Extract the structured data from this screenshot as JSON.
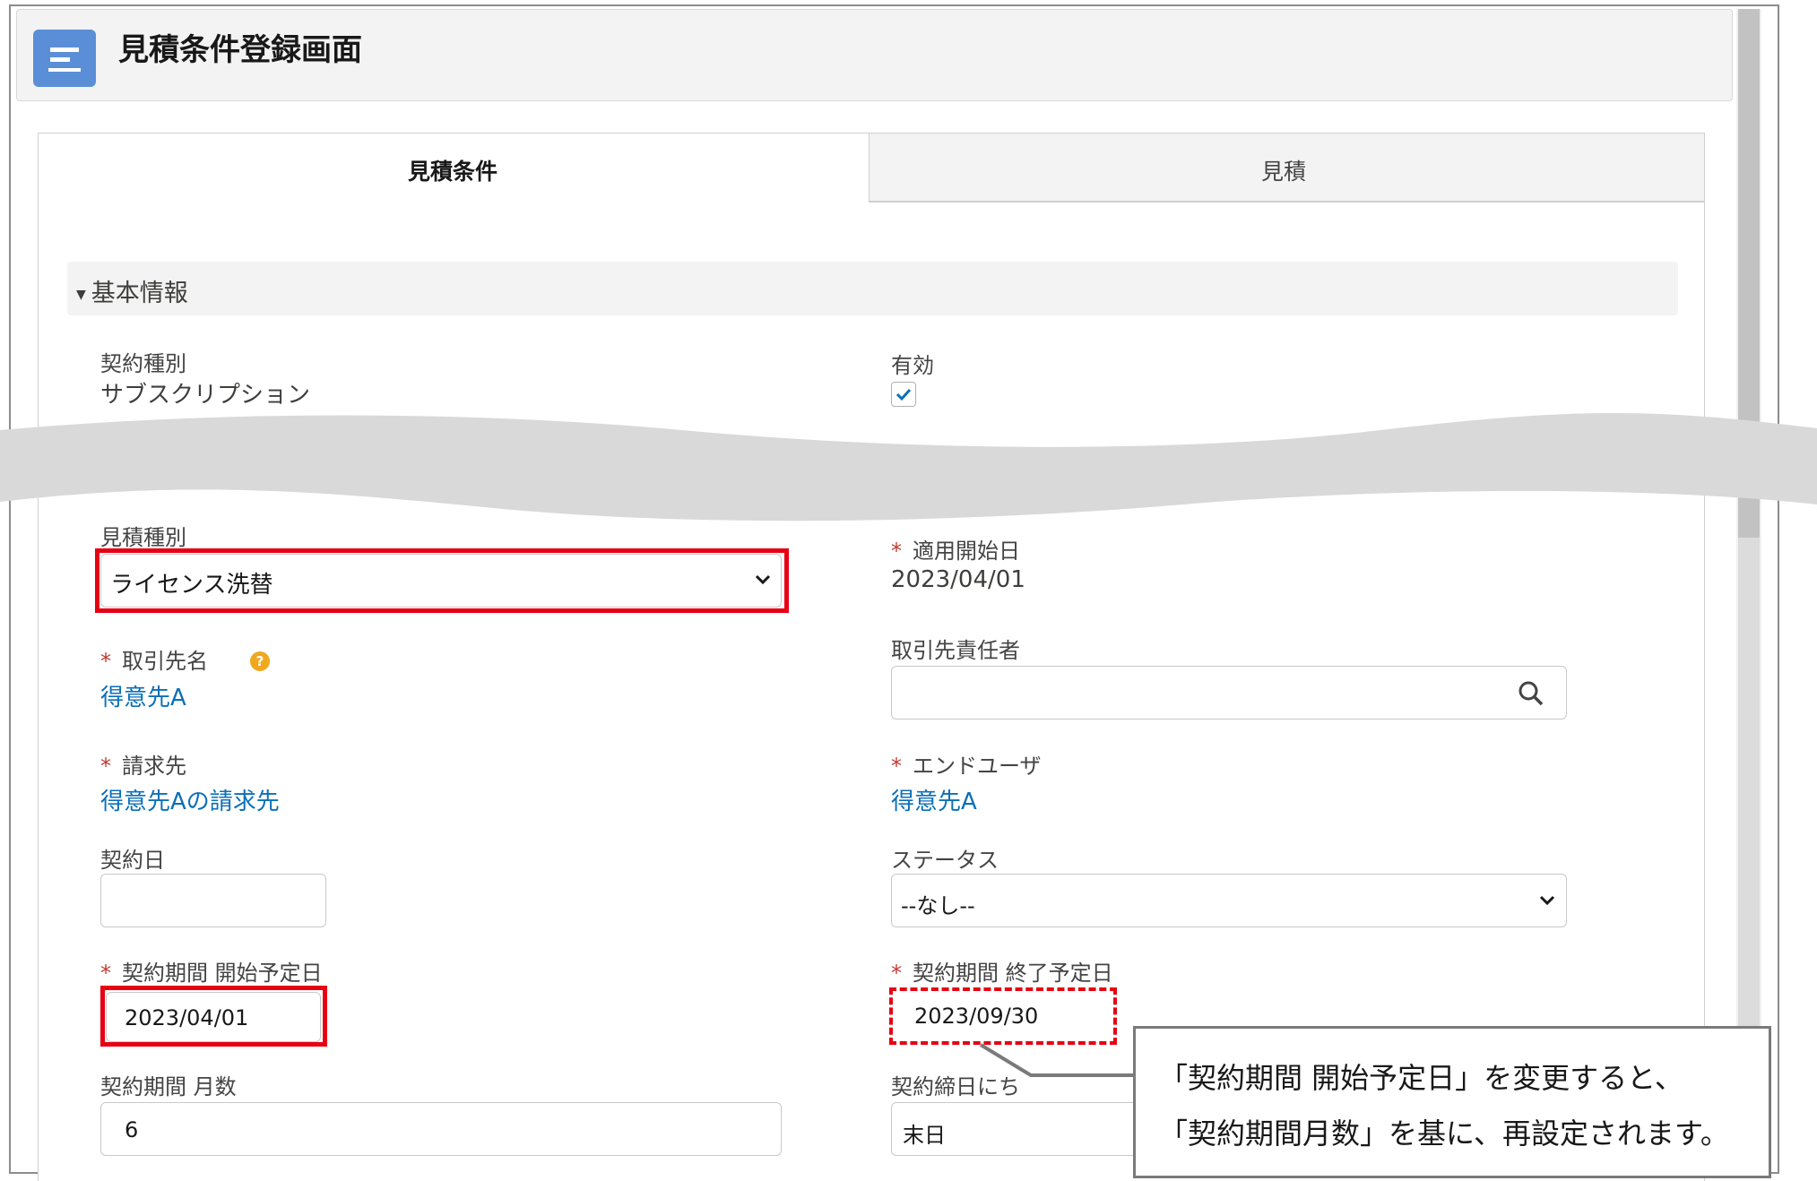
{
  "header": {
    "title": "見積条件登録画面"
  },
  "tabs": [
    {
      "label": "見積条件"
    },
    {
      "label": "見積"
    }
  ],
  "section": {
    "title": "基本情報"
  },
  "fields": {
    "contract_type": {
      "label": "契約種別",
      "value": "サブスクリプション"
    },
    "active": {
      "label": "有効",
      "checked": true
    },
    "estimate_type": {
      "label": "見積種別",
      "value": "ライセンス洗替"
    },
    "apply_start": {
      "label": "適用開始日",
      "value": "2023/04/01"
    },
    "account": {
      "label": "取引先名",
      "value": "得意先A"
    },
    "contact": {
      "label": "取引先責任者",
      "value": ""
    },
    "billing": {
      "label": "請求先",
      "value": "得意先Aの請求先"
    },
    "end_user": {
      "label": "エンドユーザ",
      "value": "得意先A"
    },
    "contract_date": {
      "label": "契約日",
      "value": ""
    },
    "status": {
      "label": "ステータス",
      "value": "--なし--"
    },
    "term_start": {
      "label": "契約期間 開始予定日",
      "value": "2023/04/01"
    },
    "term_end": {
      "label": "契約期間 終了予定日",
      "value": "2023/09/30"
    },
    "term_months": {
      "label": "契約期間 月数",
      "value": "6"
    },
    "closing_day": {
      "label": "契約締日にち",
      "value": "末日"
    }
  },
  "callout": {
    "line1": "「契約期間 開始予定日」を変更すると、",
    "line2": "「契約期間月数」を基に、再設定されます。"
  },
  "colors": {
    "accent": "#0b6fb8",
    "required": "#c23934",
    "highlight": "#e60012",
    "header_icon": "#5a8fd8"
  }
}
